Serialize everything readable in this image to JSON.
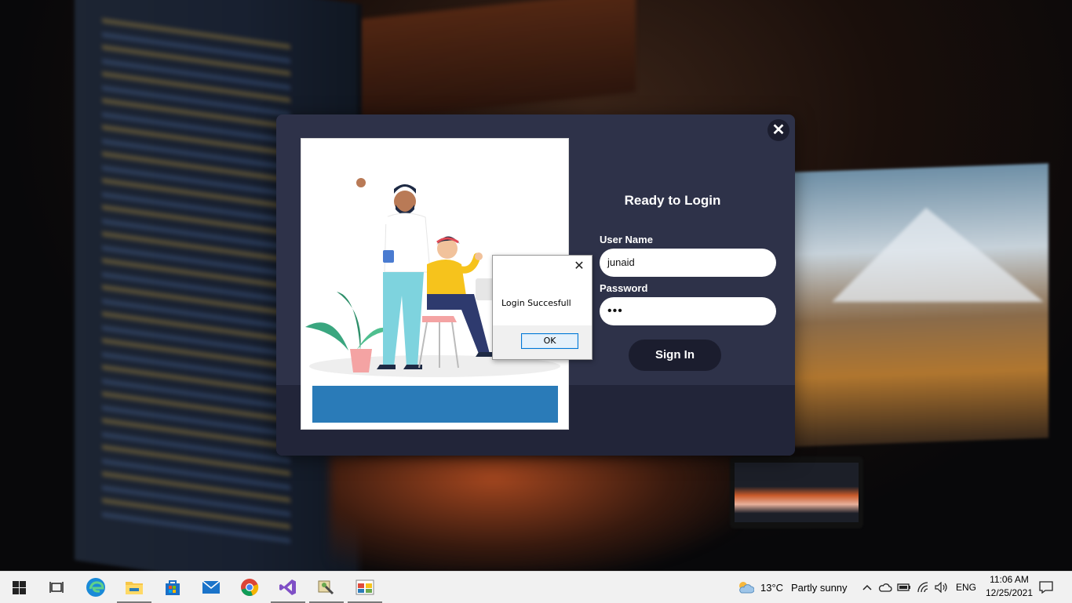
{
  "login": {
    "title": "Ready to Login",
    "username_label": "User Name",
    "username_value": "junaid",
    "password_label": "Password",
    "password_value": "•••",
    "signin_label": "Sign In",
    "close_glyph": "✕"
  },
  "message_box": {
    "text": "Login Succesfull",
    "ok_label": "OK",
    "close_glyph": "✕"
  },
  "taskbar": {
    "apps": [
      {
        "name": "start",
        "icon": "windows-logo-icon"
      },
      {
        "name": "task-view",
        "icon": "task-view-icon"
      },
      {
        "name": "edge",
        "icon": "edge-icon"
      },
      {
        "name": "file-explorer",
        "icon": "folder-icon",
        "active": true
      },
      {
        "name": "store",
        "icon": "store-icon"
      },
      {
        "name": "mail",
        "icon": "mail-icon"
      },
      {
        "name": "chrome",
        "icon": "chrome-icon"
      },
      {
        "name": "visual-studio",
        "icon": "visual-studio-icon",
        "active": true
      },
      {
        "name": "app-tool",
        "icon": "tool-app-icon",
        "active": true
      },
      {
        "name": "app-window",
        "icon": "window-app-icon",
        "active": true
      }
    ],
    "weather": {
      "temp": "13°C",
      "condition": "Partly sunny"
    },
    "language": "ENG",
    "time": "11:06 AM",
    "date": "12/25/2021"
  },
  "colors": {
    "window_bg": "#2e3249",
    "footer_bg": "#222539",
    "button_bg": "#1b1d2e",
    "accent_blue": "#2a7bb8"
  }
}
